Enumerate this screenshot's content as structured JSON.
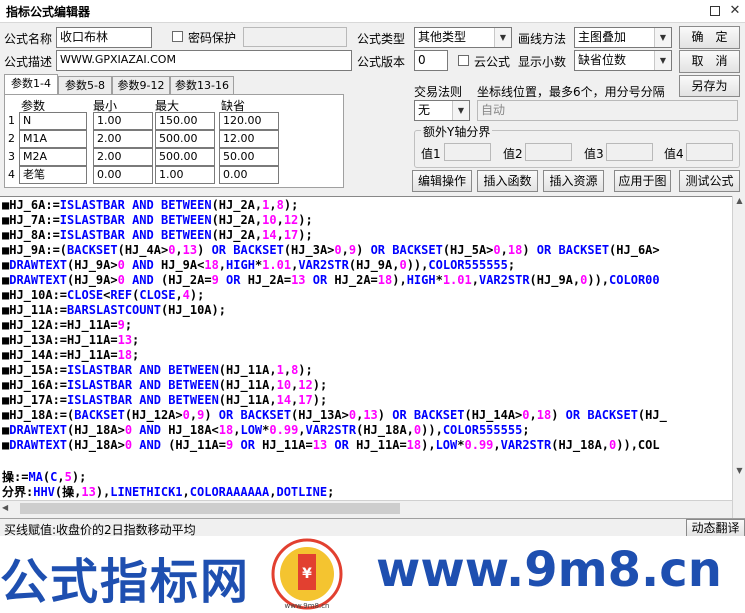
{
  "window": {
    "title": "指标公式编辑器"
  },
  "header": {
    "name_label": "公式名称",
    "name_value": "收口布林",
    "password_label": "密码保护",
    "type_label": "公式类型",
    "type_value": "其他类型",
    "draw_label": "画线方法",
    "draw_value": "主图叠加",
    "ok_button": "确　定",
    "desc_label": "公式描述",
    "desc_value": "WWW.GPXIAZAI.COM",
    "version_label": "公式版本",
    "version_value": "0",
    "cloud_label": "云公式",
    "decimals_label": "显示小数",
    "decimals_value": "缺省位数",
    "cancel_button": "取　消",
    "saveas_button": "另存为"
  },
  "tabs": [
    "参数1-4",
    "参数5-8",
    "参数9-12",
    "参数13-16"
  ],
  "params": {
    "headers": [
      "参数",
      "最小",
      "最大",
      "缺省"
    ],
    "rows": [
      {
        "idx": "1",
        "name": "N",
        "min": "1.00",
        "max": "150.00",
        "def": "120.00"
      },
      {
        "idx": "2",
        "name": "M1A",
        "min": "2.00",
        "max": "500.00",
        "def": "12.00"
      },
      {
        "idx": "3",
        "name": "M2A",
        "min": "2.00",
        "max": "500.00",
        "def": "50.00"
      },
      {
        "idx": "4",
        "name": "老笔",
        "min": "0.00",
        "max": "1.00",
        "def": "0.00"
      }
    ]
  },
  "trade": {
    "rule_label": "交易法则",
    "coord_label": "坐标线位置，最多6个，用分号分隔",
    "rule_value": "无",
    "coord_value": "自动",
    "yaxis_label": "额外Y轴分界",
    "v1": "值1",
    "v2": "值2",
    "v3": "值3",
    "v4": "值4"
  },
  "actions": [
    "编辑操作",
    "插入函数",
    "插入资源",
    "应用于图",
    "测试公式"
  ],
  "code_lines": [
    "■HJ_6A:=ISLASTBAR AND BETWEEN(HJ_2A,1,8);",
    "■HJ_7A:=ISLASTBAR AND BETWEEN(HJ_2A,10,12);",
    "■HJ_8A:=ISLASTBAR AND BETWEEN(HJ_2A,14,17);",
    "■HJ_9A:=(BACKSET(HJ_4A>0,13) OR BACKSET(HJ_3A>0,9) OR BACKSET(HJ_5A>0,18) OR BACKSET(HJ_6A>",
    "■DRAWTEXT(HJ_9A>0 AND HJ_9A<18,HIGH*1.01,VAR2STR(HJ_9A,0)),COLOR555555;",
    "■DRAWTEXT(HJ_9A>0 AND (HJ_2A=9 OR HJ_2A=13 OR HJ_2A=18),HIGH*1.01,VAR2STR(HJ_9A,0)),COLOR00",
    "■HJ_10A:=CLOSE<REF(CLOSE,4);",
    "■HJ_11A:=BARSLASTCOUNT(HJ_10A);",
    "■HJ_12A:=HJ_11A=9;",
    "■HJ_13A:=HJ_11A=13;",
    "■HJ_14A:=HJ_11A=18;",
    "■HJ_15A:=ISLASTBAR AND BETWEEN(HJ_11A,1,8);",
    "■HJ_16A:=ISLASTBAR AND BETWEEN(HJ_11A,10,12);",
    "■HJ_17A:=ISLASTBAR AND BETWEEN(HJ_11A,14,17);",
    "■HJ_18A:=(BACKSET(HJ_12A>0,9) OR BACKSET(HJ_13A>0,13) OR BACKSET(HJ_14A>0,18) OR BACKSET(HJ_",
    "■DRAWTEXT(HJ_18A>0 AND HJ_18A<18,LOW*0.99,VAR2STR(HJ_18A,0)),COLOR555555;",
    "■DRAWTEXT(HJ_18A>0 AND (HJ_11A=9 OR HJ_11A=13 OR HJ_11A=18),LOW*0.99,VAR2STR(HJ_18A,0)),COL",
    "",
    "操:=MA(C,5);",
    "分界:HHV(操,13),LINETHICK1,COLORAAAAAA,DOTLINE;"
  ],
  "status": {
    "text": "买线赋值:收盘价的2日指数移动平均",
    "button": "动态翻译"
  },
  "watermark": {
    "left_text": "公式指标网",
    "right_text": "www.9m8.cn",
    "logo_text": "www.9m8.cn"
  },
  "colors": {
    "keyword": "#0000ff",
    "number": "#ff00ff",
    "text": "#000000",
    "watermark": "#1e4fb0"
  }
}
